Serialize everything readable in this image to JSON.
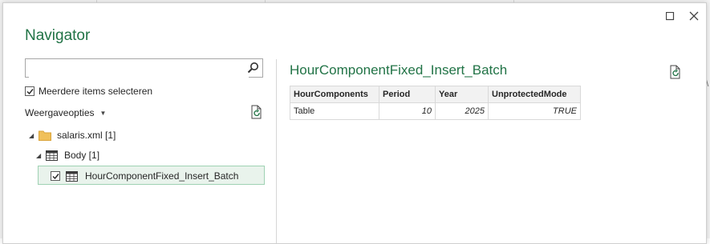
{
  "dialog": {
    "title": "Navigator"
  },
  "search": {
    "value": "",
    "placeholder": ""
  },
  "multi_select": {
    "label": "Meerdere items selecteren",
    "checked": true
  },
  "view_options": {
    "label": "Weergaveopties"
  },
  "tree": {
    "root": {
      "label": "salaris.xml [1]"
    },
    "body": {
      "label": "Body [1]"
    },
    "item": {
      "label": "HourComponentFixed_Insert_Batch",
      "checked": true
    }
  },
  "preview": {
    "title": "HourComponentFixed_Insert_Batch",
    "headers": [
      "HourComponents",
      "Period",
      "Year",
      "UnprotectedMode"
    ],
    "rows": [
      [
        "Table",
        "10",
        "2025",
        "TRUE"
      ]
    ]
  },
  "edge_glyph": "\\",
  "colors": {
    "accent": "#217346",
    "selection_bg": "#e9f3ec",
    "selection_border": "#9fd2b3"
  }
}
